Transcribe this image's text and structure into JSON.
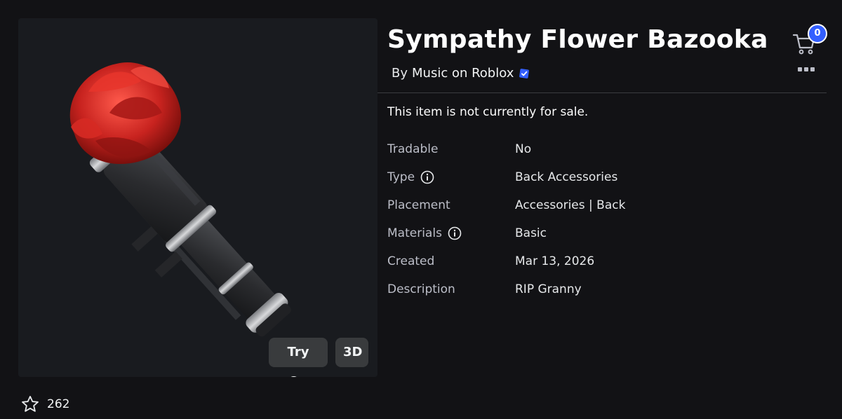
{
  "item": {
    "title": "Sympathy Flower Bazooka",
    "creator_prefix": "By",
    "creator_name": "Music on Roblox",
    "sale_status": "This item is not currently for sale."
  },
  "thumbnail": {
    "try_on_label": "Try On",
    "view_3d_label": "3D"
  },
  "favorites": {
    "count": "262"
  },
  "cart": {
    "count": "0"
  },
  "details": [
    {
      "label": "Tradable",
      "value": "No",
      "info": false
    },
    {
      "label": "Type",
      "value": "Back Accessories",
      "info": true
    },
    {
      "label": "Placement",
      "value": "Accessories | Back",
      "info": false
    },
    {
      "label": "Materials",
      "value": "Basic",
      "info": true
    },
    {
      "label": "Created",
      "value": "Mar 13, 2026",
      "info": false
    },
    {
      "label": "Description",
      "value": "RIP Granny",
      "info": false
    }
  ],
  "colors": {
    "background": "#121215",
    "panel": "#191b1f",
    "accent_blue": "#335fff",
    "button": "#393b3d",
    "rose_red": "#c8231f"
  },
  "icons": [
    "star-icon",
    "verified-icon",
    "cart-icon",
    "more-icon",
    "info-icon"
  ]
}
